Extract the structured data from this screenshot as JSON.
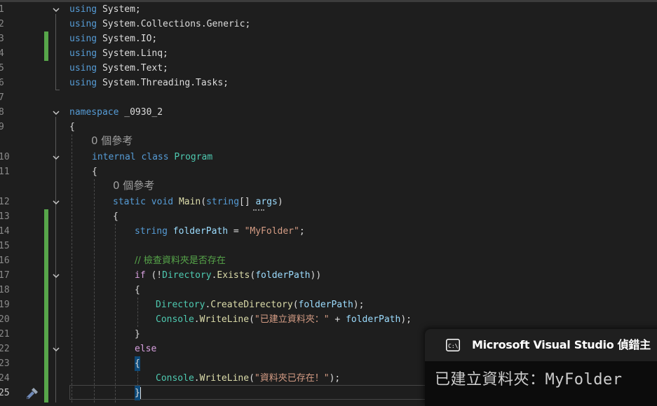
{
  "editor": {
    "line_numbers": [
      "1",
      "2",
      "3",
      "4",
      "5",
      "6",
      "7",
      "8",
      "9",
      "10",
      "11",
      "12",
      "13",
      "14",
      "15",
      "16",
      "17",
      "18",
      "19",
      "20",
      "21",
      "22",
      "23",
      "24",
      "25"
    ],
    "code_lens": {
      "class_refs": "0 個參考",
      "method_refs": "0 個參考"
    },
    "lines": {
      "l1": [
        [
          "kw",
          "using"
        ],
        [
          "pl",
          " System;"
        ]
      ],
      "l2": [
        [
          "kw",
          "using"
        ],
        [
          "pl",
          " System.Collections.Generic;"
        ]
      ],
      "l3": [
        [
          "kw",
          "using"
        ],
        [
          "pl",
          " System.IO;"
        ]
      ],
      "l4": [
        [
          "kw",
          "using"
        ],
        [
          "pl",
          " System.Linq;"
        ]
      ],
      "l5": [
        [
          "kw",
          "using"
        ],
        [
          "pl",
          " System.Text;"
        ]
      ],
      "l6": [
        [
          "kw",
          "using"
        ],
        [
          "pl",
          " System.Threading.Tasks;"
        ]
      ],
      "l8": [
        [
          "kw",
          "namespace"
        ],
        [
          "pl",
          " _0930_2"
        ]
      ],
      "l9": [
        [
          "pl",
          "{"
        ]
      ],
      "l10": [
        [
          "kw",
          "internal"
        ],
        [
          "pl",
          " "
        ],
        [
          "kw",
          "class"
        ],
        [
          "pl",
          " "
        ],
        [
          "ty",
          "Program"
        ]
      ],
      "l11": [
        [
          "pl",
          "{"
        ]
      ],
      "l12": [
        [
          "kw",
          "static"
        ],
        [
          "pl",
          " "
        ],
        [
          "kw",
          "void"
        ],
        [
          "pl",
          " "
        ],
        [
          "fn",
          "Main"
        ],
        [
          "pl",
          "("
        ],
        [
          "kw",
          "string"
        ],
        [
          "pl",
          "[] "
        ],
        [
          "id",
          "args"
        ],
        [
          "pl",
          ")"
        ]
      ],
      "l13": [
        [
          "pl",
          "{"
        ]
      ],
      "l14": [
        [
          "kw",
          "string"
        ],
        [
          "pl",
          " "
        ],
        [
          "id",
          "folderPath"
        ],
        [
          "pl",
          " = "
        ],
        [
          "st",
          "\"MyFolder\""
        ],
        [
          "pl",
          ";"
        ]
      ],
      "l16": [
        [
          "cm",
          "// 檢查資料夾是否存在"
        ]
      ],
      "l17": [
        [
          "kw2",
          "if"
        ],
        [
          "pl",
          " (!"
        ],
        [
          "ty",
          "Directory"
        ],
        [
          "pl",
          "."
        ],
        [
          "fn",
          "Exists"
        ],
        [
          "pl",
          "("
        ],
        [
          "id",
          "folderPath"
        ],
        [
          "pl",
          "))"
        ]
      ],
      "l18": [
        [
          "pl",
          "{"
        ]
      ],
      "l19": [
        [
          "ty",
          "Directory"
        ],
        [
          "pl",
          "."
        ],
        [
          "fn",
          "CreateDirectory"
        ],
        [
          "pl",
          "("
        ],
        [
          "id",
          "folderPath"
        ],
        [
          "pl",
          ");"
        ]
      ],
      "l20": [
        [
          "ty",
          "Console"
        ],
        [
          "pl",
          "."
        ],
        [
          "fn",
          "WriteLine"
        ],
        [
          "pl",
          "("
        ],
        [
          "st",
          "\"已建立資料夾：\""
        ],
        [
          "pl",
          " + "
        ],
        [
          "id",
          "folderPath"
        ],
        [
          "pl",
          ");"
        ]
      ],
      "l21": [
        [
          "pl",
          "}"
        ]
      ],
      "l22": [
        [
          "kw2",
          "else"
        ]
      ],
      "l23": [
        [
          "pl",
          "{"
        ]
      ],
      "l24": [
        [
          "ty",
          "Console"
        ],
        [
          "pl",
          "."
        ],
        [
          "fn",
          "WriteLine"
        ],
        [
          "pl",
          "("
        ],
        [
          "st",
          "\"資料夾已存在！\""
        ],
        [
          "pl",
          ");"
        ]
      ],
      "l25": [
        [
          "pl",
          "}"
        ]
      ]
    }
  },
  "console": {
    "title": "Microsoft Visual Studio 偵錯主",
    "output": "已建立資料夾：MyFolder",
    "icon": "console-cmd-icon"
  },
  "colors": {
    "background": "#1e1e1e",
    "keyword": "#569cd6",
    "control_keyword": "#d8a0df",
    "type": "#4ec9b0",
    "method": "#dcdcaa",
    "string": "#d69d85",
    "identifier": "#9cdcfe",
    "comment": "#57a64a",
    "change_bar": "#57a64a"
  }
}
